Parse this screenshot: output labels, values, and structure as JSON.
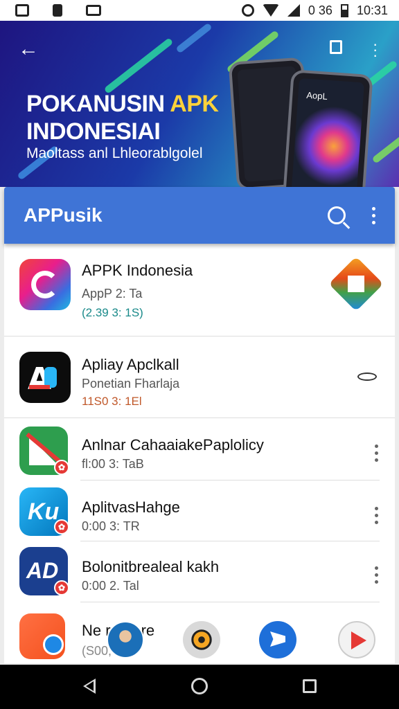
{
  "status_bar": {
    "status_text": "0 36",
    "time": "10:31"
  },
  "hero": {
    "title_line1_main": "POKANUSIN ",
    "title_line1_accent": "APK",
    "title_line2": "INDONESIAI",
    "subtitle": "Maoltass anl Lhleorablgolel",
    "phone_label": "AopL"
  },
  "appbar": {
    "title": "APPusik"
  },
  "apps": [
    {
      "name": "APPK Indonesia",
      "subtitle": "AppP 2: Ta",
      "meta": "(2.39 3: 1S)",
      "meta_color": "#1a8a8a"
    },
    {
      "name": "Apliay Apclkall",
      "subtitle": "Ponetian Fharlaja",
      "meta": "11S0 3: 1El",
      "meta_color": "#c0582a"
    },
    {
      "name": "Anlnar CahaaiakePaplolicy",
      "subtitle": "fl:00 3: TaB",
      "meta": ""
    },
    {
      "name": "AplitvasHahge",
      "subtitle": "0:00 3: TR",
      "meta": ""
    },
    {
      "name": "Bolonitbrealeal kakh",
      "subtitle": "0:00 2. Tal",
      "meta": ""
    },
    {
      "name": "Ne         rnarpre",
      "subtitle": "(S00,",
      "meta": ""
    }
  ],
  "badge_glyph": "✿",
  "colors": {
    "app_bar": "#3f74d6",
    "hero_start": "#1e1580",
    "hero_end": "#2aa0c8"
  }
}
